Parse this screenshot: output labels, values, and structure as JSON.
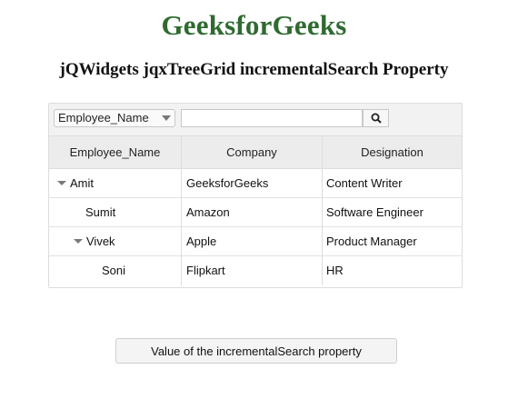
{
  "page": {
    "site_title": "GeeksforGeeks",
    "demo_title": "jQWidgets jqxTreeGrid incrementalSearch Property"
  },
  "toolbar": {
    "field_selected": "Employee_Name",
    "search_value": "",
    "search_icon": "search-icon"
  },
  "grid": {
    "columns": [
      "Employee_Name",
      "Company",
      "Designation"
    ],
    "rows": [
      {
        "name": "Amit",
        "company": "GeeksforGeeks",
        "designation": "Content Writer",
        "expanded": true,
        "level": 0
      },
      {
        "name": "Sumit",
        "company": "Amazon",
        "designation": "Software Engineer",
        "level": 1
      },
      {
        "name": "Vivek",
        "company": "Apple",
        "designation": "Product Manager",
        "expanded": true,
        "level": 1
      },
      {
        "name": "Soni",
        "company": "Flipkart",
        "designation": "HR",
        "level": 2
      }
    ]
  },
  "button": {
    "label": "Value of the incrementalSearch property"
  },
  "colors": {
    "title_green": "#2f6a31",
    "toolbar_bg": "#f2f2f2",
    "header_bg": "#ececec"
  }
}
